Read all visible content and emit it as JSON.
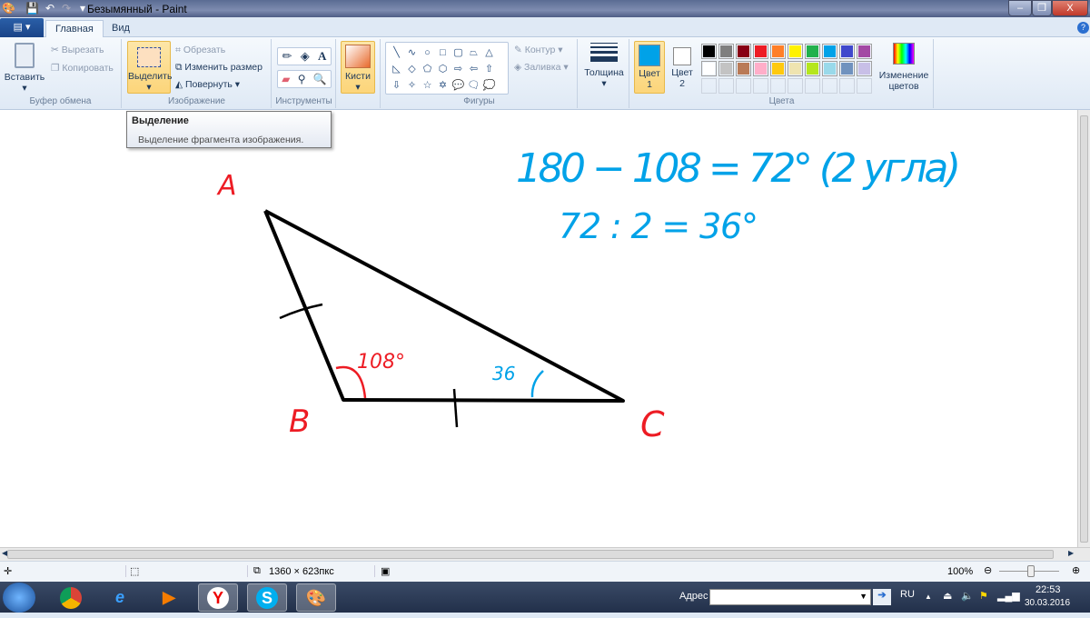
{
  "window": {
    "title": "Безымянный - Paint",
    "minimize": "–",
    "maximize": "❐",
    "close": "X",
    "help": "?"
  },
  "tabs": [
    {
      "label": "Главная"
    },
    {
      "label": "Вид"
    }
  ],
  "clipboard": {
    "paste": "Вставить",
    "cut": "Вырезать",
    "copy": "Копировать",
    "label": "Буфер обмена"
  },
  "image": {
    "select": "Выделить",
    "crop": "Обрезать",
    "resize": "Изменить размер",
    "rotate": "Повернуть",
    "label": "Изображение"
  },
  "tools": {
    "label": "Инструменты",
    "text_glyph": "A"
  },
  "brushes": {
    "label": "Кисти"
  },
  "shapes": {
    "outline": "Контур",
    "fill": "Заливка",
    "label": "Фигуры",
    "glyphs": [
      "╲",
      "∿",
      "○",
      "□",
      "▢",
      "⏢",
      "△",
      "◺",
      "◇",
      "⬠",
      "⬡",
      "⇨",
      "⇦",
      "⇧",
      "⇩",
      "✧",
      "☆",
      "✡",
      "💬",
      "🗨",
      "💭"
    ]
  },
  "thickness": {
    "label": "Толщина"
  },
  "colors": {
    "color1": "Цвет",
    "color1_num": "1",
    "color2": "Цвет",
    "color2_num": "2",
    "edit": "Изменение",
    "edit2": "цветов",
    "label": "Цвета",
    "primary": "#00a2e8",
    "secondary": "#ffffff",
    "palette_row1": [
      "#000000",
      "#7f7f7f",
      "#880015",
      "#ed1c24",
      "#ff7f27",
      "#fff200",
      "#22b14c",
      "#00a2e8",
      "#3f48cc",
      "#a349a4"
    ],
    "palette_row2": [
      "#ffffff",
      "#c3c3c3",
      "#b97a57",
      "#ffaec9",
      "#ffc90e",
      "#efe4b0",
      "#b5e61d",
      "#99d9ea",
      "#7092be",
      "#c8bfe7"
    ]
  },
  "tooltip": {
    "title": "Выделение",
    "text": "Выделение фрагмента изображения."
  },
  "drawing": {
    "label_a": "A",
    "label_b": "B",
    "label_c": "C",
    "angle_b": "108°",
    "angle_c": "36",
    "eq1": "180 − 108 = 72° (2 угла)",
    "eq2": "72 : 2 = 36°",
    "red": "#ed1c24",
    "blue": "#00a2e8"
  },
  "status": {
    "size": "1360 × 623пкс",
    "zoom": "100%"
  },
  "taskbar": {
    "address_label": "Адрес",
    "lang": "RU",
    "time": "22:53",
    "date": "30.03.2016",
    "apps": [
      "chrome",
      "ie",
      "media",
      "yandex",
      "skype",
      "paint"
    ],
    "yandex_glyph": "Y",
    "skype_glyph": "S"
  }
}
